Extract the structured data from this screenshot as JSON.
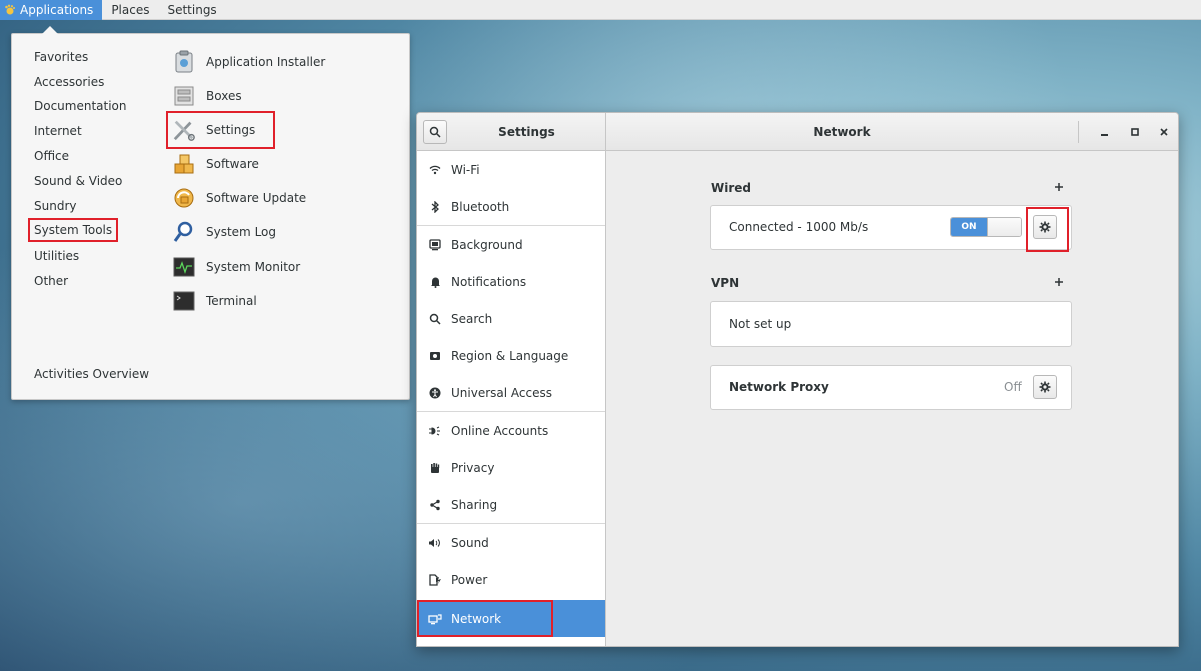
{
  "topbar": {
    "applications": "Applications",
    "places": "Places",
    "settings": "Settings"
  },
  "apps_menu": {
    "categories": [
      "Favorites",
      "Accessories",
      "Documentation",
      "Internet",
      "Office",
      "Sound & Video",
      "Sundry",
      "System Tools",
      "Utilities",
      "Other"
    ],
    "apps": [
      "Application Installer",
      "Boxes",
      "Settings",
      "Software",
      "Software Update",
      "System Log",
      "System Monitor",
      "Terminal"
    ],
    "activities": "Activities Overview"
  },
  "window": {
    "sidebar_title": "Settings",
    "title": "Network",
    "sidebar": [
      "Wi-Fi",
      "Bluetooth",
      "Background",
      "Notifications",
      "Search",
      "Region & Language",
      "Universal Access",
      "Online Accounts",
      "Privacy",
      "Sharing",
      "Sound",
      "Power",
      "Network"
    ],
    "wired": {
      "title": "Wired",
      "status": "Connected - 1000 Mb/s",
      "switch_label": "ON"
    },
    "vpn": {
      "title": "VPN",
      "status": "Not set up"
    },
    "proxy": {
      "title": "Network Proxy",
      "value": "Off"
    }
  },
  "colors": {
    "accent": "#4a90d9",
    "highlight_box": "#e0202a"
  }
}
